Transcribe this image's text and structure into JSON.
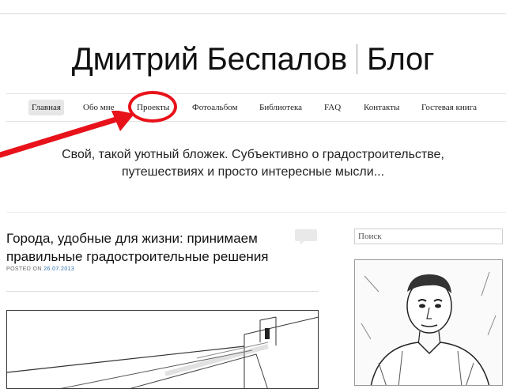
{
  "site": {
    "title_name": "Дмитрий Беспалов",
    "title_blog": "Блог",
    "tagline_line1": "Свой, такой уютный бложек. Субъективно о градостроительстве,",
    "tagline_line2": "путешествиях и просто интересные мысли..."
  },
  "nav": {
    "items": [
      {
        "label": "Главная",
        "active": true
      },
      {
        "label": "Обо мне"
      },
      {
        "label": "Проекты"
      },
      {
        "label": "Фотоальбом"
      },
      {
        "label": "Библиотека"
      },
      {
        "label": "FAQ"
      },
      {
        "label": "Контакты"
      },
      {
        "label": "Гостевая книга"
      }
    ]
  },
  "post": {
    "title_line1": "Города, удобные для жизни: принимаем",
    "title_line2": "правильные градостроительные решения",
    "posted_on_label": "POSTED ON",
    "date": "26.07.2013"
  },
  "sidebar": {
    "search_placeholder": "Поиск"
  },
  "colors": {
    "annotation_red": "#e8121a",
    "link_blue": "#2a6fb0",
    "active_nav_bg": "#e6e6e6"
  },
  "icons": {
    "comment": "comment-bubble-icon",
    "annotation_arrow": "red-arrow-icon",
    "annotation_circle": "red-circle-highlight"
  }
}
